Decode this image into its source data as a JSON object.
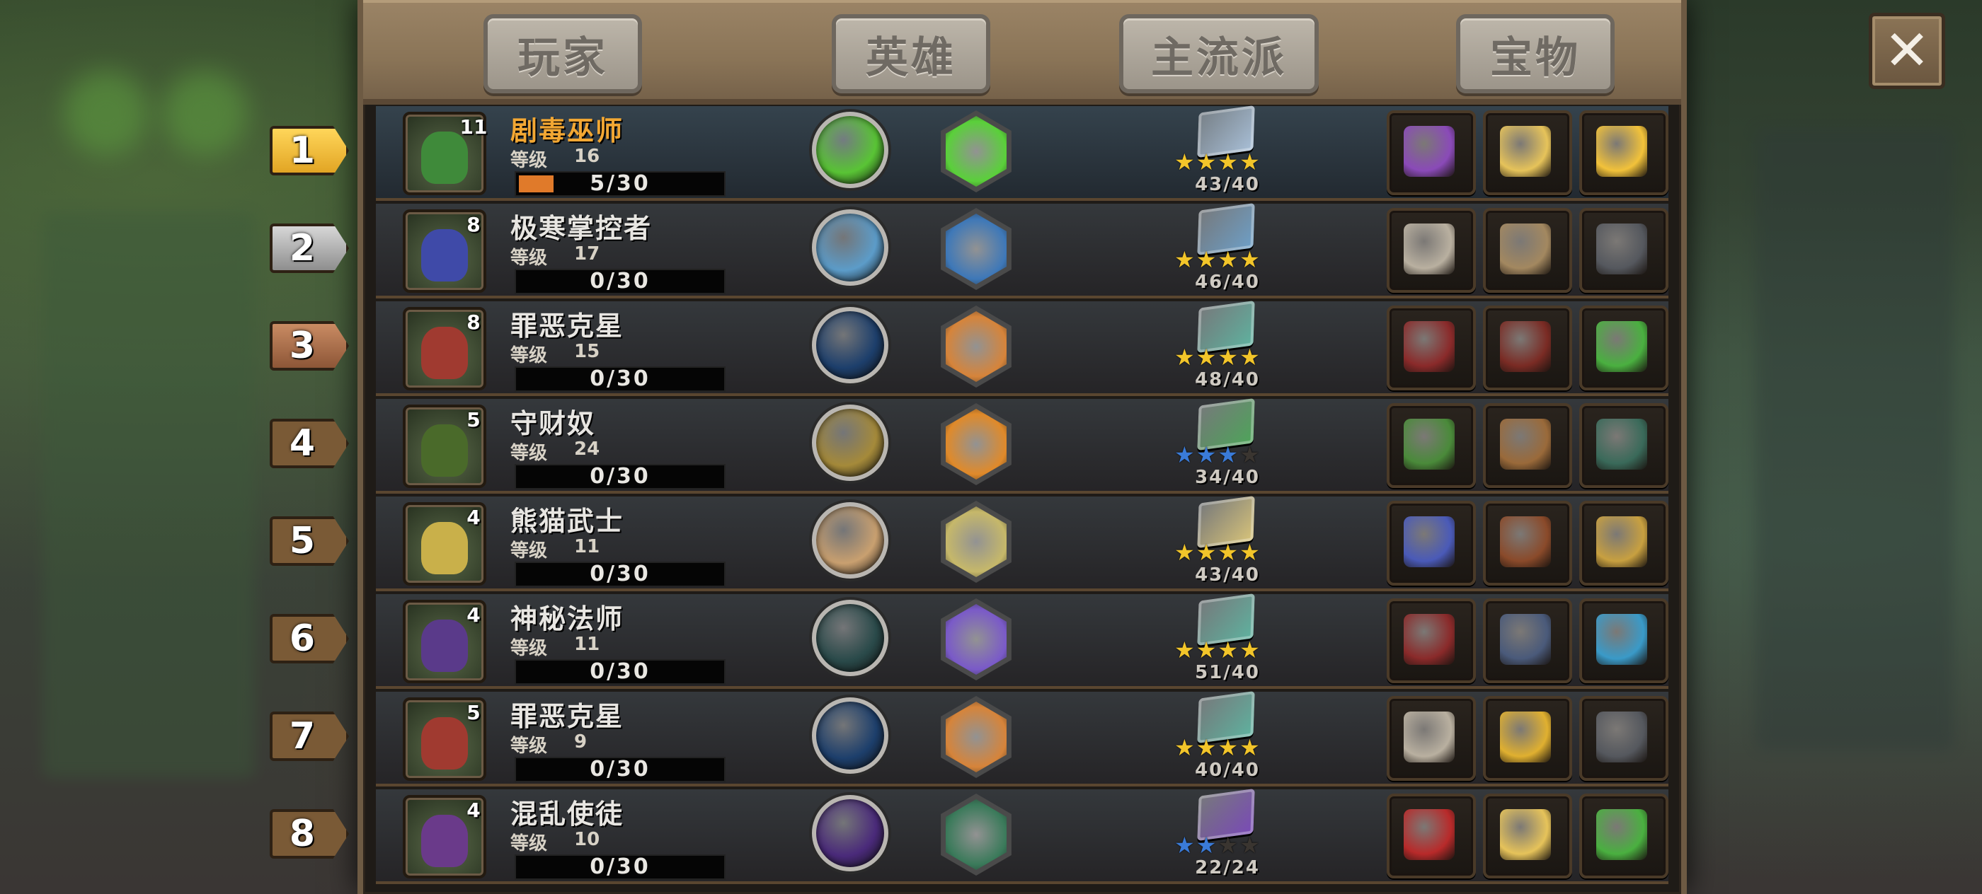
{
  "tabs": [
    {
      "label": "玩家"
    },
    {
      "label": "英雄"
    },
    {
      "label": "主流派"
    },
    {
      "label": "宝物"
    }
  ],
  "close_label": "✕",
  "level_label": "等级",
  "rows": [
    {
      "rank": "1",
      "hero_level": "11",
      "name": "剧毒巫师",
      "level": "16",
      "xp": "5/30",
      "xp_progress": 0.17,
      "rating": "43/40",
      "stars_filled": 4,
      "star_color": "gold",
      "portrait_color": "#3f8a3a",
      "circle_color": "#59c435",
      "hex_color": "#5ad03a",
      "book_color": "#a9c0d8",
      "treasures": [
        "potion-icon",
        "pocket-watch-icon",
        "crown-icon"
      ],
      "treasure_colors": [
        "#8a4ab8",
        "#e6c35a",
        "#f2c23a"
      ]
    },
    {
      "rank": "2",
      "hero_level": "8",
      "name": "极寒掌控者",
      "level": "17",
      "xp": "0/30",
      "xp_progress": 0,
      "rating": "46/40",
      "stars_filled": 4,
      "star_color": "gold",
      "portrait_color": "#3f4aa8",
      "circle_color": "#5c9cc9",
      "hex_color": "#3e78b8",
      "book_color": "#6ea0c8",
      "treasures": [
        "bottle-cap-icon",
        "scales-icon",
        "horned-helmet-icon"
      ],
      "treasure_colors": [
        "#b9b0a0",
        "#a38860",
        "#55585e"
      ]
    },
    {
      "rank": "3",
      "hero_level": "8",
      "name": "罪恶克星",
      "level": "15",
      "xp": "0/30",
      "xp_progress": 0,
      "rating": "48/40",
      "stars_filled": 4,
      "star_color": "gold",
      "portrait_color": "#a03a30",
      "circle_color": "#1d3f6c",
      "hex_color": "#d6843a",
      "book_color": "#5fb3a0",
      "treasures": [
        "spellbook-icon",
        "ninja-boot-icon",
        "green-potion-icon"
      ],
      "treasure_colors": [
        "#8a2a2a",
        "#7a2b24",
        "#4ab040"
      ]
    },
    {
      "rank": "4",
      "hero_level": "5",
      "name": "守财奴",
      "level": "24",
      "xp": "0/30",
      "xp_progress": 0,
      "rating": "34/40",
      "stars_filled": 3,
      "star_color": "blue",
      "portrait_color": "#4a6a2a",
      "circle_color": "#a58a3a",
      "hex_color": "#e08a2a",
      "book_color": "#4ea55a",
      "treasures": [
        "cash-stack-icon",
        "treasure-chest-icon",
        "dragon-emblem-icon"
      ],
      "treasure_colors": [
        "#4a8a3a",
        "#9a6a3a",
        "#3a6a5a"
      ]
    },
    {
      "rank": "5",
      "hero_level": "4",
      "name": "熊猫武士",
      "level": "11",
      "xp": "0/30",
      "xp_progress": 0,
      "rating": "43/40",
      "stars_filled": 4,
      "star_color": "gold",
      "portrait_color": "#c9b04a",
      "circle_color": "#c9a070",
      "hex_color": "#c6b86a",
      "book_color": "#d8c47a",
      "treasures": [
        "sapphire-ring-icon",
        "leather-armor-icon",
        "golden-staff-icon"
      ],
      "treasure_colors": [
        "#4a5ab8",
        "#8a4a2a",
        "#c8a040"
      ]
    },
    {
      "rank": "6",
      "hero_level": "4",
      "name": "神秘法师",
      "level": "11",
      "xp": "0/30",
      "xp_progress": 0,
      "rating": "51/40",
      "stars_filled": 4,
      "star_color": "gold",
      "portrait_color": "#5a3a8a",
      "circle_color": "#2a4a4a",
      "hex_color": "#7a5ac8",
      "book_color": "#5fb3a0",
      "treasures": [
        "spellbook-icon",
        "open-tome-icon",
        "blue-staff-icon"
      ],
      "treasure_colors": [
        "#8a2a2a",
        "#4a5a7a",
        "#3a9ac8"
      ]
    },
    {
      "rank": "7",
      "hero_level": "5",
      "name": "罪恶克星",
      "level": "9",
      "xp": "0/30",
      "xp_progress": 0,
      "rating": "40/40",
      "stars_filled": 4,
      "star_color": "gold",
      "portrait_color": "#a03a30",
      "circle_color": "#1d3f6c",
      "hex_color": "#d6843a",
      "book_color": "#5fb3a0",
      "treasures": [
        "bottle-cap-icon",
        "gold-ore-icon",
        "horned-helmet-icon"
      ],
      "treasure_colors": [
        "#b9b0a0",
        "#e0b030",
        "#55585e"
      ]
    },
    {
      "rank": "8",
      "hero_level": "4",
      "name": "混乱使徒",
      "level": "10",
      "xp": "0/30",
      "xp_progress": 0,
      "rating": "22/24",
      "stars_filled": 2,
      "star_color": "blue",
      "portrait_color": "#6a3a8a",
      "circle_color": "#4a2a7a",
      "hex_color": "#3a7a5a",
      "book_color": "#7a4ab8",
      "treasures": [
        "red-crystal-icon",
        "pocket-watch-icon",
        "green-potion-icon"
      ],
      "treasure_colors": [
        "#b82a2a",
        "#e6c35a",
        "#4ab040"
      ]
    }
  ]
}
